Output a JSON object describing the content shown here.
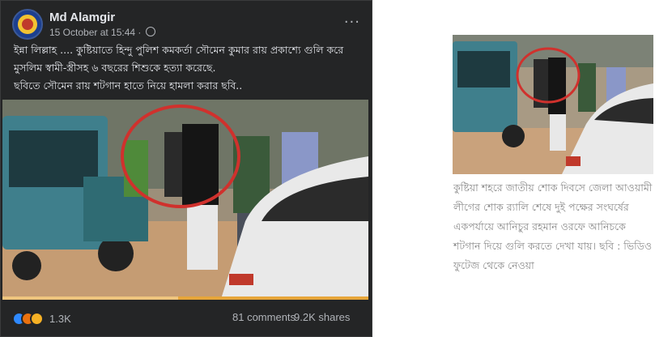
{
  "post": {
    "author": "Md Alamgir",
    "timestamp": "15 October at 15:44 ·",
    "more_icon": "ellipsis-icon",
    "privacy_icon": "globe-icon",
    "text_line1": "ইন্না লিল্লাহ .... কুষ্টিয়াতে হিন্দু পুলিশ কমকর্তা সৌমেন কুমার রায় প্রকাশ্যে গুলি করে মুসলিম স্বামী-স্ত্রীসহ ৬ বছরের শিশুকে হত্যা করেছে.",
    "text_line2": "ছবিতে সৌমেন রায় শটগান হাতে নিয়ে হামলা করার ছবি.."
  },
  "video": {
    "progress": 0.48
  },
  "footer": {
    "reaction_count": "1.3K",
    "comments": "81 comments",
    "shares": "9.2K shares",
    "reaction_icons": [
      "like-icon",
      "angry-icon",
      "sad-icon"
    ]
  },
  "news": {
    "caption": "কুষ্টিয়া শহরে জাতীয় শোক দিবসে জেলা আওয়ামী লীগের শোক র‍্যালি শেষে দুই পক্ষের সংঘর্ষের একপর্যায়ে আনিচুর রহমান ওরফে আনিচকে শটগান দিয়ে গুলি করতে দেখা যায়। ছবি : ভিডিও ফুটেজ থেকে নেওয়া"
  },
  "colors": {
    "fb_bg": "#242526",
    "fb_text": "#e4e6eb",
    "muted": "#b0b3b8",
    "highlight_circle": "#d0312d",
    "seek_bar": "#e7a63a"
  }
}
